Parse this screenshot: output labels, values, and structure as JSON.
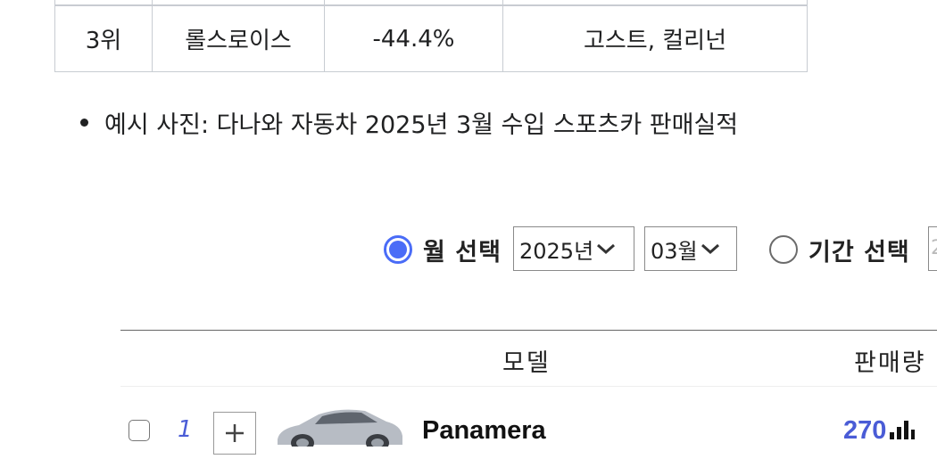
{
  "rank_table": {
    "row": {
      "rank": "3위",
      "brand": "롤스로이스",
      "change": "-44.4%",
      "models": "고스트, 컬리넌"
    }
  },
  "bullet_text": "예시 사진: 다나와 자동차 2025년 3월 수입 스포츠카 판매실적",
  "filter": {
    "month_radio_label": "월 선택",
    "month_radio_checked": true,
    "year_select": "2025년",
    "month_select": "03월",
    "period_radio_label": "기간 선택",
    "period_radio_checked": false,
    "period_start_partial": "2"
  },
  "list": {
    "header": {
      "model": "모델",
      "sales": "판매량"
    },
    "rows": [
      {
        "rank": "1",
        "model": "Panamera",
        "sales": "270"
      }
    ]
  },
  "colors": {
    "accent": "#4a6cf7",
    "link": "#4a5cd6",
    "border": "#c8ccd2"
  },
  "icons": [
    "chevron-down-icon",
    "plus-icon",
    "bar-chart-icon"
  ]
}
